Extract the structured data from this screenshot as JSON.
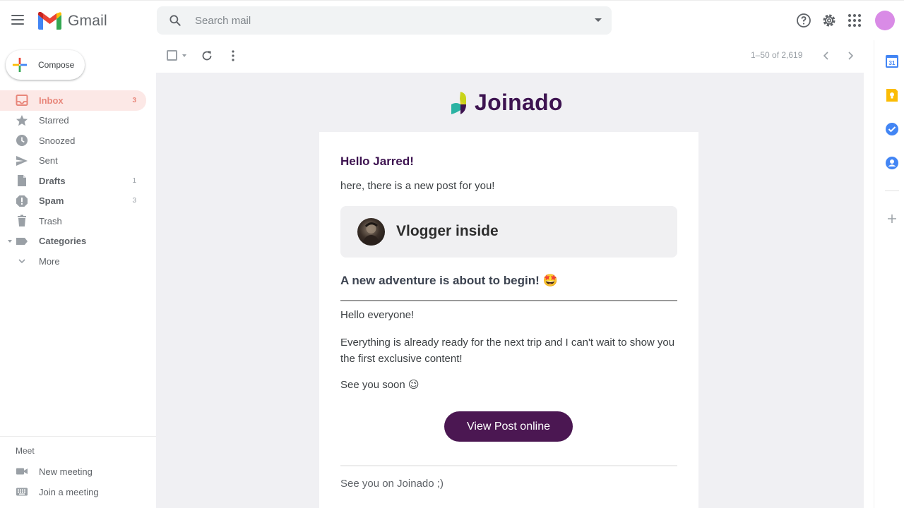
{
  "app": {
    "name": "Gmail",
    "brand_colors": [
      "#ea4335",
      "#4285f4",
      "#34a853",
      "#fbbc05",
      "#c5221f"
    ]
  },
  "search": {
    "placeholder": "Search mail",
    "value": ""
  },
  "header_icons": [
    "help-icon",
    "settings-icon",
    "apps-icon",
    "account-avatar"
  ],
  "compose": {
    "label": "Compose"
  },
  "sidebar": {
    "items": [
      {
        "label": "Inbox",
        "count": "3",
        "icon": "inbox-icon",
        "active": true
      },
      {
        "label": "Starred",
        "count": "",
        "icon": "star-icon"
      },
      {
        "label": "Snoozed",
        "count": "",
        "icon": "clock-icon"
      },
      {
        "label": "Sent",
        "count": "",
        "icon": "send-icon"
      },
      {
        "label": "Drafts",
        "count": "1",
        "icon": "draft-icon"
      },
      {
        "label": "Spam",
        "count": "3",
        "icon": "spam-icon"
      },
      {
        "label": "Trash",
        "count": "",
        "icon": "trash-icon"
      },
      {
        "label": "Categories",
        "count": "",
        "icon": "label-icon"
      },
      {
        "label": "More",
        "count": "",
        "icon": "chevron-down-icon"
      }
    ],
    "meet": {
      "title": "Meet",
      "items": [
        {
          "label": "New meeting",
          "icon": "video-icon"
        },
        {
          "label": "Join a meeting",
          "icon": "keyboard-icon"
        }
      ]
    }
  },
  "toolbar": {
    "pager": "1–50 of 2,619"
  },
  "email": {
    "brand": "Joinado",
    "brand_color": "#3d1350",
    "greeting": "Hello Jarred!",
    "intro": "here, there is a new post for you!",
    "author": "Vlogger inside",
    "post_title": "A new adventure is about to begin!",
    "post_title_emoji": "🤩",
    "para1": "Hello everyone!",
    "para2": "Everything is already ready for the next trip and I can't wait to show you the first exclusive content!",
    "para3": "See you soon",
    "para3_emoji": "😉",
    "cta_label": "View Post online",
    "cta_color": "#4b1752",
    "footer": "See you on Joinado ;)"
  },
  "right_rail": {
    "icons": [
      "calendar-icon",
      "keep-icon",
      "tasks-icon",
      "contacts-icon",
      "add-icon"
    ],
    "calendar_day": "31"
  }
}
